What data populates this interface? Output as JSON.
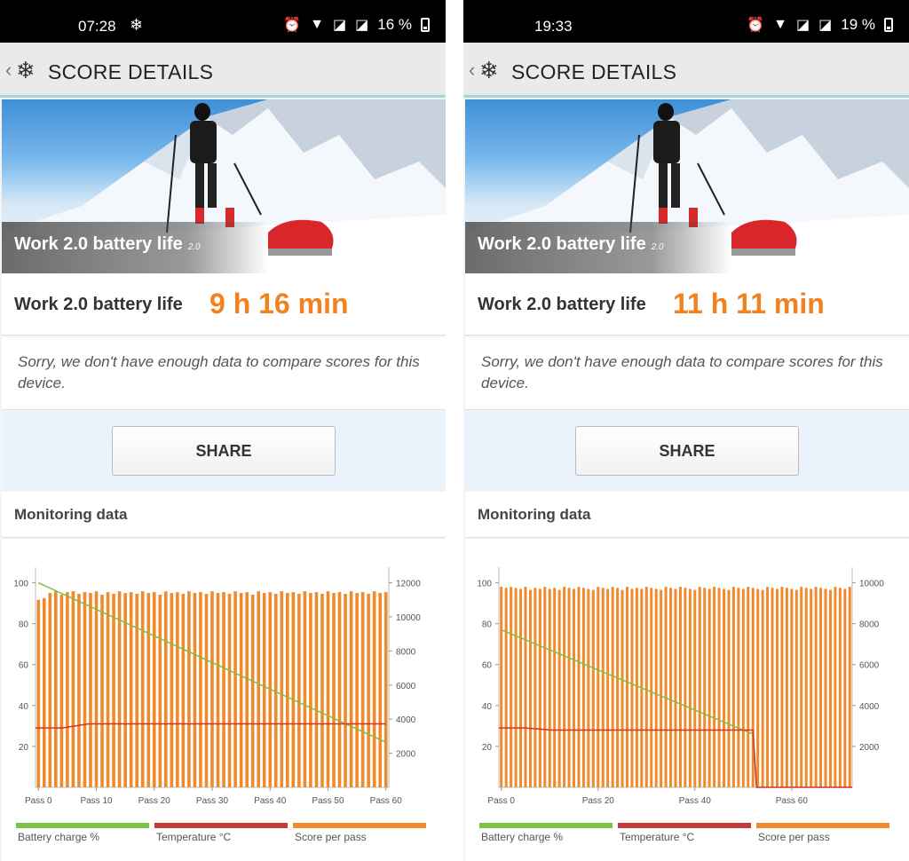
{
  "panels": [
    {
      "status": {
        "time": "07:28",
        "extra_icon": "snowflake-icon",
        "battery": "16 %"
      },
      "appbar": {
        "title": "SCORE DETAILS"
      },
      "hero": {
        "caption": "Work 2.0 battery life",
        "version": "2.0"
      },
      "result": {
        "label": "Work 2.0 battery life",
        "value": "9 h 16 min"
      },
      "note": "Sorry, we don't have enough data to compare scores for this device.",
      "share_label": "SHARE",
      "monitoring_title": "Monitoring data",
      "chart_data": {
        "type": "bar",
        "left_axis": {
          "ticks": [
            100,
            80,
            60,
            40,
            20
          ],
          "range": [
            0,
            105
          ]
        },
        "right_axis": {
          "ticks": [
            12000,
            10000,
            8000,
            6000,
            4000,
            2000
          ],
          "range": [
            0,
            12600
          ]
        },
        "x_ticks": [
          "Pass 0",
          "Pass 10",
          "Pass 20",
          "Pass 30",
          "Pass 40",
          "Pass 50",
          "Pass 60"
        ],
        "passes": 61,
        "score_per_pass": [
          11000,
          11100,
          11400,
          11500,
          11300,
          11450,
          11500,
          11350,
          11450,
          11400,
          11500,
          11300,
          11450,
          11350,
          11500,
          11400,
          11450,
          11350,
          11500,
          11400,
          11450,
          11300,
          11500,
          11400,
          11450,
          11350,
          11500,
          11400,
          11450,
          11350,
          11500,
          11400,
          11450,
          11350,
          11500,
          11400,
          11450,
          11300,
          11500,
          11400,
          11450,
          11350,
          11500,
          11400,
          11450,
          11350,
          11500,
          11400,
          11450,
          11350,
          11500,
          11400,
          11450,
          11350,
          11500,
          11400,
          11450,
          11350,
          11500,
          11400,
          11450
        ],
        "battery_charge": {
          "start": 100,
          "end": 22,
          "start_pass": 0,
          "end_pass": 60
        },
        "temperature": {
          "start": 29,
          "mid": 31,
          "end": 31
        },
        "legend": [
          "Battery charge %",
          "Temperature °C",
          "Score per pass"
        ]
      }
    },
    {
      "status": {
        "time": "19:33",
        "extra_icon": "",
        "battery": "19 %"
      },
      "appbar": {
        "title": "SCORE DETAILS"
      },
      "hero": {
        "caption": "Work 2.0 battery life",
        "version": "2.0"
      },
      "result": {
        "label": "Work 2.0 battery life",
        "value": "11 h 11 min"
      },
      "note": "Sorry, we don't have enough data to compare scores for this device.",
      "share_label": "SHARE",
      "monitoring_title": "Monitoring data",
      "chart_data": {
        "type": "bar",
        "left_axis": {
          "ticks": [
            100,
            80,
            60,
            40,
            20
          ],
          "range": [
            0,
            105
          ]
        },
        "right_axis": {
          "ticks": [
            10000,
            8000,
            6000,
            4000,
            2000
          ],
          "range": [
            0,
            10500
          ]
        },
        "x_ticks": [
          "Pass 0",
          "Pass 20",
          "Pass 40",
          "Pass 60"
        ],
        "passes": 73,
        "score_per_pass": [
          9800,
          9750,
          9800,
          9750,
          9700,
          9800,
          9650,
          9750,
          9700,
          9800,
          9700,
          9750,
          9650,
          9800,
          9750,
          9700,
          9800,
          9750,
          9700,
          9650,
          9800,
          9750,
          9700,
          9800,
          9750,
          9650,
          9800,
          9700,
          9750,
          9700,
          9800,
          9750,
          9700,
          9650,
          9800,
          9750,
          9700,
          9800,
          9750,
          9700,
          9650,
          9800,
          9750,
          9700,
          9800,
          9750,
          9700,
          9650,
          9800,
          9750,
          9700,
          9800,
          9750,
          9700,
          9650,
          9800,
          9750,
          9700,
          9800,
          9750,
          9700,
          9650,
          9800,
          9750,
          9700,
          9800,
          9750,
          9700,
          9650,
          9800,
          9750,
          9700,
          9800
        ],
        "battery_charge": {
          "start": 77,
          "end": 26,
          "start_pass": 0,
          "end_pass": 52
        },
        "temperature": {
          "start": 29,
          "mid": 28,
          "end": 28
        },
        "legend": [
          "Battery charge %",
          "Temperature °C",
          "Score per pass"
        ]
      }
    }
  ]
}
